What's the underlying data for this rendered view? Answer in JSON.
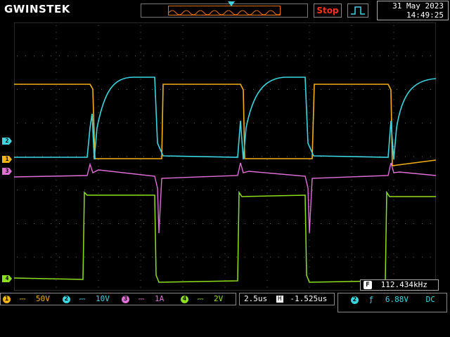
{
  "header": {
    "brand": "GWINSTEK",
    "run_state": "Stop",
    "date": "31 May 2023",
    "time": "14:49:25"
  },
  "channels": [
    {
      "num": "1",
      "scale": "50V",
      "color": "#f2b21a"
    },
    {
      "num": "2",
      "scale": "10V",
      "color": "#3cd5e0"
    },
    {
      "num": "3",
      "scale": "1A",
      "color": "#e070d8"
    },
    {
      "num": "4",
      "scale": "2V",
      "color": "#8ee01e"
    }
  ],
  "timebase": {
    "scale": "2.5us",
    "h_badge": "H",
    "delay": "-1.525us"
  },
  "trigger": {
    "source": "2",
    "slope_symbol": "ƒ",
    "level": "6.88V",
    "coupling": "DC"
  },
  "frequency": {
    "badge": "F",
    "value": "112.434kHz"
  },
  "markers": [
    {
      "label": "2",
      "color": "#3cd5e0"
    },
    {
      "label": "1",
      "color": "#f2b21a"
    },
    {
      "label": "3",
      "color": "#e070d8"
    },
    {
      "label": "4",
      "color": "#8ee01e"
    }
  ]
}
